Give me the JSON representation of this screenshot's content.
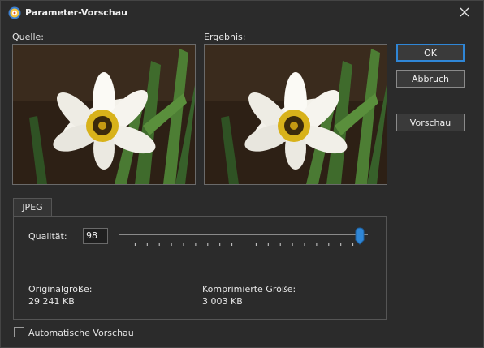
{
  "window": {
    "title": "Parameter-Vorschau",
    "close_icon": "close-icon"
  },
  "preview": {
    "source_label": "Quelle:",
    "result_label": "Ergebnis:"
  },
  "buttons": {
    "ok": "OK",
    "cancel": "Abbruch",
    "preview": "Vorschau"
  },
  "jpeg": {
    "tab_label": "JPEG",
    "quality_label": "Qualität:",
    "quality_value": "98",
    "slider_level": 0.98,
    "original_size_label": "Originalgröße:",
    "original_size_value": "29 241 KB",
    "compressed_size_label": "Komprimierte Größe:",
    "compressed_size_value": "3 003 KB"
  },
  "auto_preview": {
    "label": "Automatische Vorschau",
    "checked": false
  },
  "colors": {
    "accent": "#2f86d6",
    "background": "#2b2b2b"
  }
}
